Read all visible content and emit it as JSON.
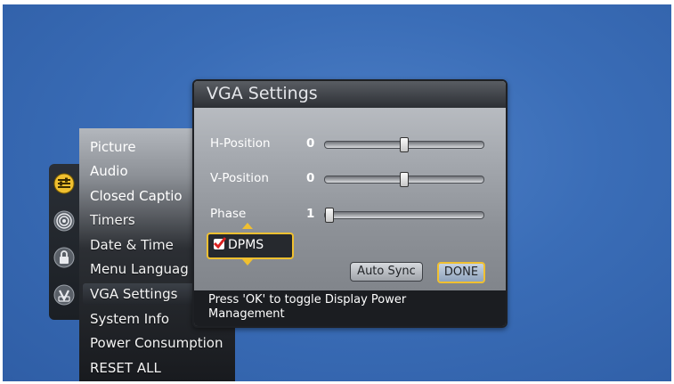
{
  "icon_strip": {
    "icons": [
      "settings-sliders-icon",
      "broadcast-icon",
      "lock-icon",
      "v-chip-icon"
    ]
  },
  "main_menu": {
    "items": [
      {
        "label": "Picture"
      },
      {
        "label": "Audio"
      },
      {
        "label": "Closed Captio"
      },
      {
        "label": "Timers"
      },
      {
        "label": "Date & Time"
      },
      {
        "label": "Menu Languag"
      },
      {
        "label": "VGA Settings",
        "selected": true
      },
      {
        "label": "System Info"
      },
      {
        "label": "Power Consumption"
      },
      {
        "label": "RESET ALL"
      }
    ]
  },
  "vga_dialog": {
    "title": "VGA Settings",
    "h_position": {
      "label": "H-Position",
      "value": "0",
      "level": 0.5
    },
    "v_position": {
      "label": "V-Position",
      "value": "0",
      "level": 0.5
    },
    "phase": {
      "label": "Phase",
      "value": "1",
      "level": 0.0
    },
    "dpms": {
      "label": "DPMS",
      "checked": true
    },
    "auto_sync_label": "Auto Sync",
    "done_label": "DONE",
    "help_text": "Press 'OK' to toggle Display Power Management"
  },
  "colors": {
    "accent": "#f0c030",
    "background": "#3a6db7"
  }
}
